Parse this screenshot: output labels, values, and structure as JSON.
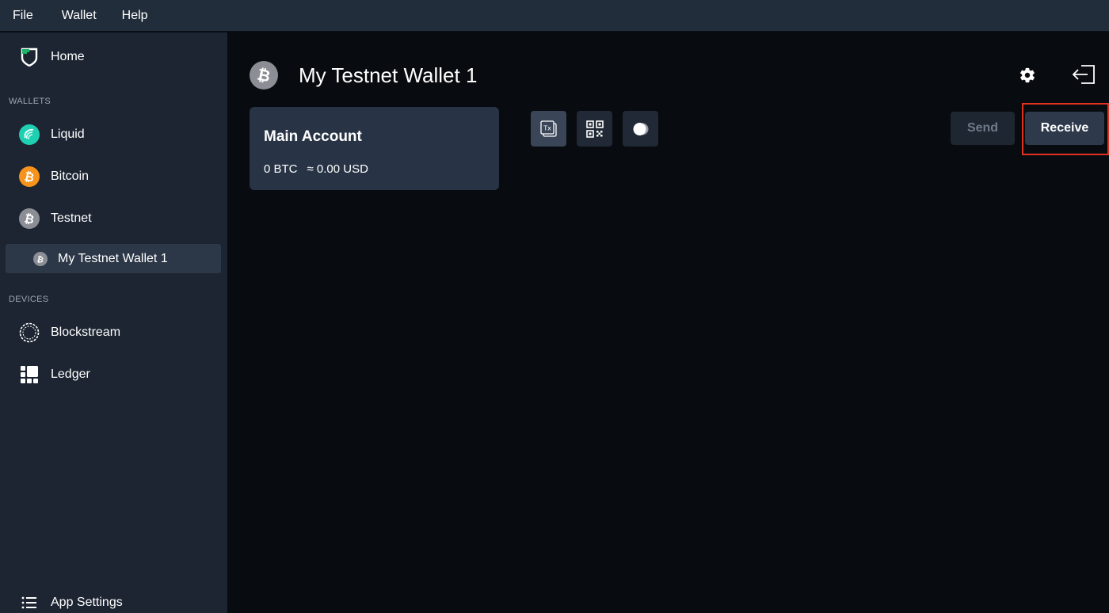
{
  "menubar": {
    "items": [
      "File",
      "Wallet",
      "Help"
    ]
  },
  "sidebar": {
    "home": {
      "label": "Home",
      "icon": "shield-logo-icon"
    },
    "wallets_heading": "WALLETS",
    "wallets": [
      {
        "label": "Liquid",
        "icon": "liquid-icon"
      },
      {
        "label": "Bitcoin",
        "icon": "bitcoin-icon"
      },
      {
        "label": "Testnet",
        "icon": "testnet-icon"
      }
    ],
    "selected_wallet": {
      "label": "My Testnet Wallet 1",
      "icon": "testnet-coin-icon"
    },
    "devices_heading": "DEVICES",
    "devices": [
      {
        "label": "Blockstream",
        "icon": "blockstream-jade-icon"
      },
      {
        "label": "Ledger",
        "icon": "ledger-icon"
      }
    ],
    "app_settings": {
      "label": "App Settings",
      "icon": "list-icon"
    }
  },
  "main": {
    "wallet_title": "My Testnet Wallet 1",
    "account": {
      "name": "Main Account",
      "balance_btc": "0 BTC",
      "balance_fiat": "≈ 0.00 USD"
    },
    "toolbar": {
      "tx_icon_label": "Tx",
      "icons": [
        "transactions-icon",
        "qr-code-icon",
        "coins-icon"
      ]
    },
    "actions": {
      "send_label": "Send",
      "receive_label": "Receive"
    }
  },
  "colors": {
    "menubar_bg": "#222d3c",
    "sidebar_bg": "#1d2532",
    "main_bg": "#080b0f",
    "card_bg": "#283446",
    "liquid_accent": "#1fcfb2",
    "bitcoin_orange": "#f7931a",
    "testnet_gray": "#8b8f95",
    "highlight_red": "#e0321f",
    "home_green": "#1fb26b"
  }
}
